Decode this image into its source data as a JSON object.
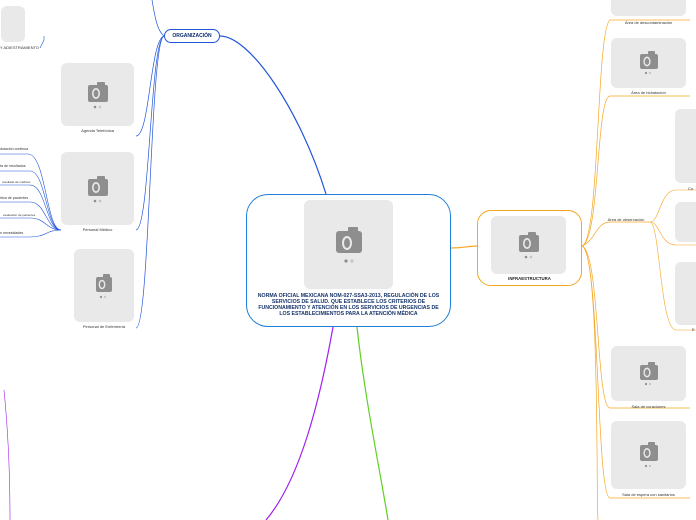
{
  "central": {
    "title": "NORMA OFICIAL MEXICANA NOM-027-SSA3-2013, REGULACIÓN DE LOS SERVICIOS DE SALUD. QUE ESTABLECE LOS CRITERIOS DE FUNCIONAMIENTO Y ATENCIÓN EN LOS SERVICIOS DE URGENCIAS DE LOS ESTABLECIMIENTOS PARA LA ATENCIÓN MÉDICA"
  },
  "organizacion": {
    "label": "ORGANIZACIÓN",
    "cards": {
      "agenda": "Agenda Telefónica",
      "medico": "Personal Médico",
      "enfermeria": "Personal de Enfermería"
    },
    "left_items": {
      "adiestramiento": "Y ADIESTRAMIENTO",
      "item1": "dotación continua",
      "item2": "ta de resultados",
      "item3": "resultado de médicos",
      "item4": "rtica de pacientes",
      "item5": "evaluación de pacientes",
      "item6": "n necesidades"
    }
  },
  "infraestructura": {
    "label": "INFRAESTRUCTURA",
    "cards": {
      "descontaminacion": "Área de descontaminación",
      "hidratacion": "Área de hidratación",
      "observacion": "Área de observación",
      "curaciones": "Sala de curaciones",
      "espera": "Sala de espera con sanitarios",
      "partial_1": "Cu",
      "partial_2": "E"
    }
  },
  "colors": {
    "organizacion": "#2156d9",
    "infraestructura": "#f5a623",
    "purple_branch": "#a020f0",
    "green_branch": "#5fd021",
    "photo_bg": "#e9e9ea"
  }
}
